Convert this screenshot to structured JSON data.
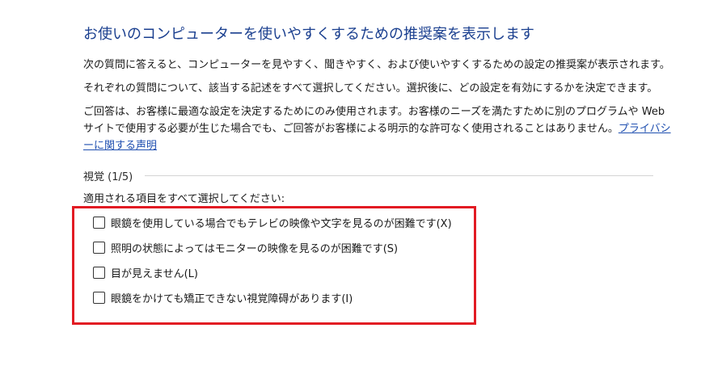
{
  "page": {
    "title": "お使いのコンピューターを使いやすくするための推奨案を表示します",
    "intro1": "次の質問に答えると、コンピューターを見やすく、聞きやすく、および使いやすくするための設定の推奨案が表示されます。",
    "intro2": "それぞれの質問について、該当する記述をすべて選択してください。選択後に、どの設定を有効にするかを決定できます。",
    "intro3": "ご回答は、お客様に最適な設定を決定するためにのみ使用されます。お客様のニーズを満たすために別のプログラムや Web サイトで使用する必要が生じた場合でも、ご回答がお客様による明示的な許可なく使用されることはありません。",
    "privacy_link": "プライバシーに関する声明"
  },
  "section": {
    "label": "視覚 (1/5)",
    "instruction": "適用される項目をすべて選択してください:"
  },
  "options": [
    {
      "label": "眼鏡を使用している場合でもテレビの映像や文字を見るのが困難です(X)",
      "checked": false
    },
    {
      "label": "照明の状態によってはモニターの映像を見るのが困難です(S)",
      "checked": false
    },
    {
      "label": "目が見えません(L)",
      "checked": false
    },
    {
      "label": "眼鏡をかけても矯正できない視覚障碍があります(I)",
      "checked": false
    }
  ],
  "colors": {
    "title": "#1a3f8f",
    "link": "#1f4fb0",
    "highlight_border": "#e21b23"
  }
}
